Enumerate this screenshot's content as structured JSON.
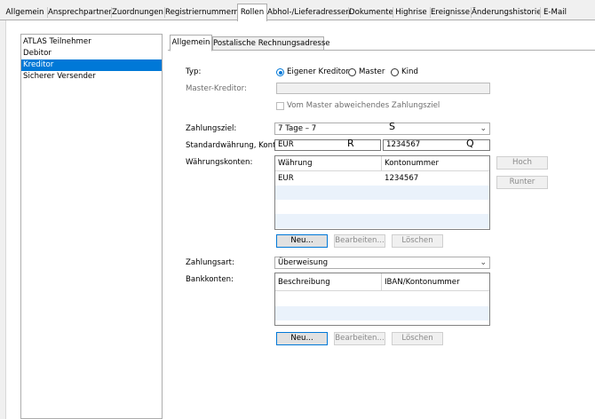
{
  "top_tabs": [
    "Allgemein",
    "Ansprechpartner",
    "Zuordnungen",
    "Registriernummern",
    "Rollen",
    "Abhol-/Lieferadressen",
    "Dokumente",
    "Highrise",
    "Ereignisse",
    "Änderungshistorie",
    "E-Mail"
  ],
  "selected_top_tab": "Rollen",
  "roles": [
    "ATLAS Teilnehmer",
    "Debitor",
    "Kreditor",
    "Sicherer Versender"
  ],
  "selected_role": "Kreditor",
  "inner_tabs": [
    "Allgemein",
    "Postalische Rechnungsadresse"
  ],
  "form": {
    "typ_label": "Typ:",
    "typ_options": [
      "Eigener Kreditor",
      "Master",
      "Kind"
    ],
    "typ_selected": "Eigener Kreditor",
    "master_label": "Master-Kreditor:",
    "master_value": "",
    "vom_master_label": "Vom Master abweichendes Zahlungsziel",
    "zahlungsziel_label": "Zahlungsziel:",
    "zahlungsziel_value": "7 Tage – 7",
    "waehrung_label": "Standardwährung, Konto:",
    "waehrung_value": "EUR",
    "konto_value": "1234567",
    "overlay_s": "S",
    "overlay_r": "R",
    "overlay_q": "Q",
    "waehrungskonten_label": "Währungskonten:",
    "zahlungsart_label": "Zahlungsart:",
    "zahlungsart_value": "Überweisung",
    "bankkonten_label": "Bankkonten:"
  },
  "waehrungskonten_table": {
    "columns": [
      "Währung",
      "Kontonummer"
    ],
    "rows": [
      [
        "EUR",
        "1234567"
      ]
    ]
  },
  "bankkonten_table": {
    "columns": [
      "Beschreibung",
      "IBAN/Kontonummer"
    ],
    "rows": []
  },
  "buttons": {
    "neu": "Neu...",
    "bearbeiten": "Bearbeiten...",
    "loeschen": "Löschen",
    "hoch": "Hoch",
    "runter": "Runter"
  }
}
